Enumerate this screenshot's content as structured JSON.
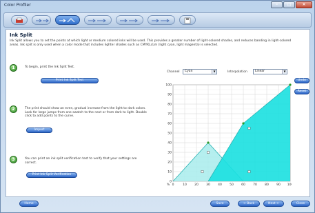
{
  "window": {
    "title": "Color Profiler"
  },
  "tabs": [
    {
      "name": "tab-printer",
      "active": false
    },
    {
      "name": "tab-step-2",
      "active": false
    },
    {
      "name": "tab-ink-split",
      "active": true
    },
    {
      "name": "tab-step-4",
      "active": false
    },
    {
      "name": "tab-step-5",
      "active": false
    },
    {
      "name": "tab-step-6",
      "active": false
    },
    {
      "name": "tab-save",
      "active": false
    }
  ],
  "page": {
    "heading": "Ink Split",
    "description": "Ink Split allows you to set the points at which light or medium colored inks will be used. This provides a greater number of light-colored shades, and reduces banding in light-colored areas. Ink split is only used when a color mode that includes lighter shades such as CMYKLcLm (light cyan, light magenta) is selected."
  },
  "steps": [
    {
      "number": "1",
      "text": "To begin, print the Ink Split Test.",
      "button": "Print Ink Split Test"
    },
    {
      "number": "2",
      "text": "The print should show an even, gradual increase from the light to dark colors. Look for large jumps from one swatch to the next or from dark to light. Double click to add points to the curve.",
      "button": "Import"
    },
    {
      "number": "3",
      "text": "You can print an ink split verification test to verify that your settings are correct.",
      "button": "Print Ink Split Verification"
    }
  ],
  "controls": {
    "channel_label": "Channel",
    "channel_value": "Cyan",
    "interp_label": "Interpolation",
    "interp_value": "Linear"
  },
  "side_buttons": {
    "undo": "Undo",
    "reset": "Reset"
  },
  "bottom_buttons": {
    "home": "Home",
    "save": "Save",
    "back": "< Back",
    "next": "Next >",
    "close": "Close"
  },
  "colors": {
    "accent": "#2a62c4",
    "light_ink": "#a8ecec",
    "dark_ink": "#19e0e0",
    "curve": "#29b3b3"
  },
  "chart_data": {
    "type": "area",
    "xlabel": "%",
    "xlim": [
      0,
      100
    ],
    "ylim": [
      0,
      100
    ],
    "x_ticks": [
      0,
      10,
      20,
      30,
      40,
      50,
      60,
      70,
      80,
      90,
      100
    ],
    "y_ticks": [
      0,
      10,
      20,
      30,
      40,
      50,
      60,
      70,
      80,
      90,
      100
    ],
    "grid": true,
    "series": [
      {
        "x": [
          0,
          30,
          60
        ],
        "y": [
          0,
          40,
          0
        ]
      },
      {
        "x": [
          30,
          60,
          100
        ],
        "y": [
          0,
          60,
          100
        ]
      }
    ],
    "handles": [
      {
        "x": 30,
        "y": 40
      },
      {
        "x": 30,
        "y": 30
      },
      {
        "x": 25,
        "y": 10
      },
      {
        "x": 60,
        "y": 60
      },
      {
        "x": 65,
        "y": 55
      },
      {
        "x": 65,
        "y": 10
      },
      {
        "x": 100,
        "y": 100
      }
    ]
  }
}
